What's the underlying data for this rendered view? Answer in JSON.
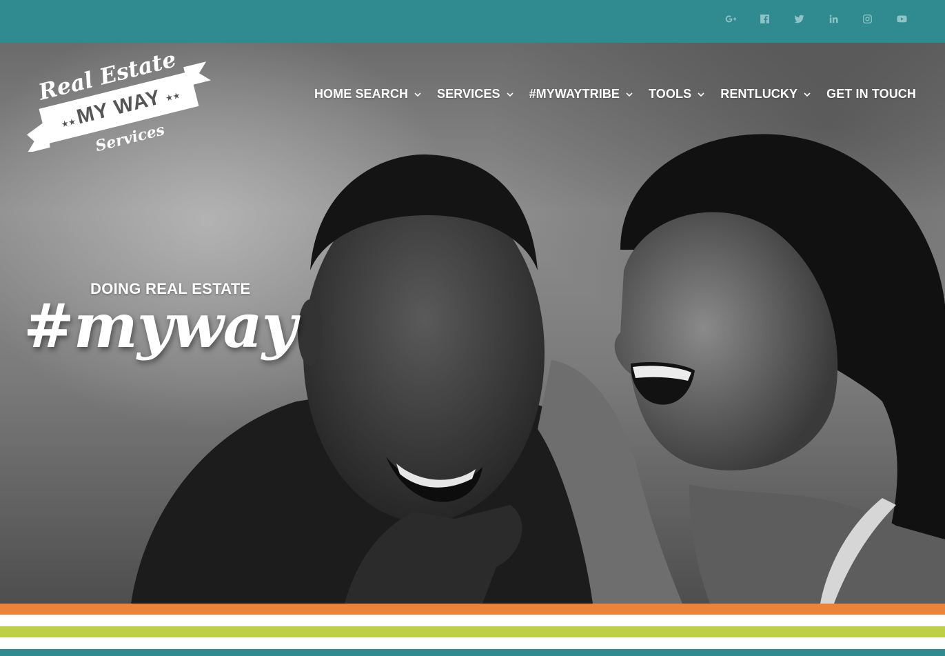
{
  "colors": {
    "teal": "#2f8b90",
    "orange": "#ec8338",
    "lime": "#bccf45",
    "white": "#ffffff"
  },
  "social": [
    {
      "name": "google-plus-icon"
    },
    {
      "name": "facebook-icon"
    },
    {
      "name": "twitter-icon"
    },
    {
      "name": "linkedin-icon"
    },
    {
      "name": "instagram-icon"
    },
    {
      "name": "youtube-icon"
    }
  ],
  "logo": {
    "line1": "Real Estate",
    "line2": "MY WAY",
    "line3": "Services"
  },
  "nav": [
    {
      "label": "HOME SEARCH",
      "dropdown": true
    },
    {
      "label": "SERVICES",
      "dropdown": true
    },
    {
      "label": "#MYWAYTRIBE",
      "dropdown": true
    },
    {
      "label": "TOOLS",
      "dropdown": true
    },
    {
      "label": "RENTLUCKY",
      "dropdown": true
    },
    {
      "label": "GET IN TOUCH",
      "dropdown": false
    }
  ],
  "hero": {
    "subtitle": "DOING REAL ESTATE",
    "title": "#myway"
  }
}
